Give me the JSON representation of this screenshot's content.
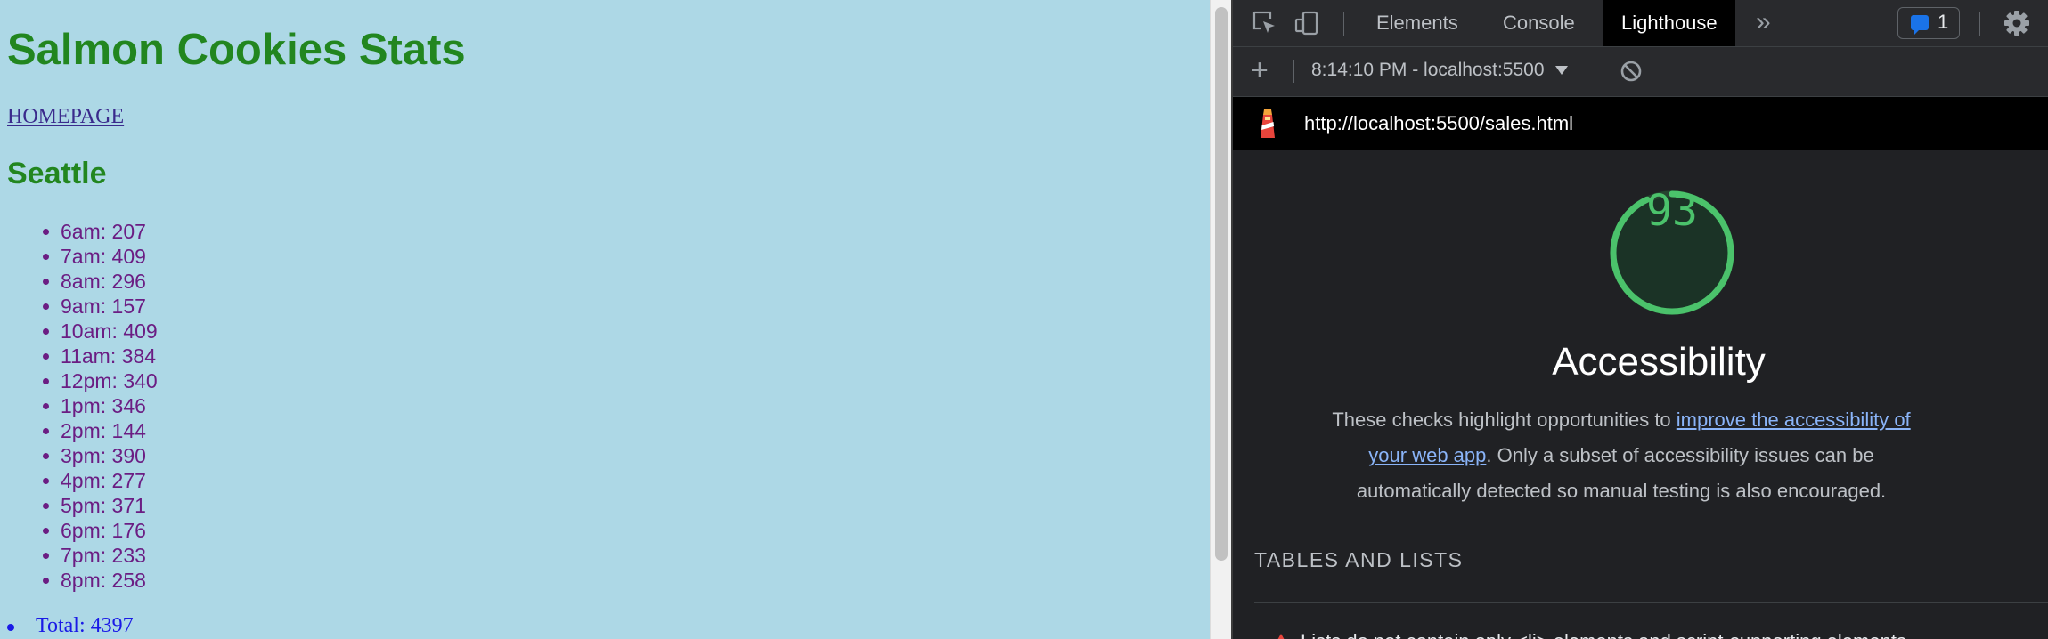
{
  "page": {
    "title": "Salmon Cookies Stats",
    "home_link": "HOMEPAGE",
    "store_name": "Seattle",
    "hours": [
      "6am: 207",
      "7am: 409",
      "8am: 296",
      "9am: 157",
      "10am: 409",
      "11am: 384",
      "12pm: 340",
      "1pm: 346",
      "2pm: 144",
      "3pm: 390",
      "4pm: 277",
      "5pm: 371",
      "6pm: 176",
      "7pm: 233",
      "8pm: 258"
    ],
    "total": "Total: 4397"
  },
  "devtools": {
    "tabs": [
      "Elements",
      "Console",
      "Lighthouse"
    ],
    "active_tab": "Lighthouse",
    "issues_count": "1",
    "report_selector": "8:14:10 PM - localhost:5500",
    "url": "http://localhost:5500/sales.html",
    "score": "93",
    "category_title": "Accessibility",
    "description_before": "These checks highlight opportunities to ",
    "description_link": "improve the accessibility of your web app",
    "description_after": ". Only a subset of accessibility issues can be automatically detected so manual testing is also encouraged.",
    "section_title": "TABLES AND LISTS",
    "audit_peek": "Lists do not contain only <li> elements and script-supporting elements"
  },
  "colors": {
    "page_bg": "#add8e6",
    "heading_green": "#22861f",
    "list_purple": "#6b1d83",
    "score_green": "#4bc26b",
    "devtools_bg": "#202124"
  },
  "icons": [
    "inspect-element-icon",
    "device-toolbar-icon",
    "more-tabs-icon",
    "issues-message-icon",
    "gear-icon",
    "add-icon",
    "caret-down-icon",
    "clear-icon",
    "lighthouse-icon",
    "fail-triangle-icon"
  ],
  "score_fraction": 0.93
}
